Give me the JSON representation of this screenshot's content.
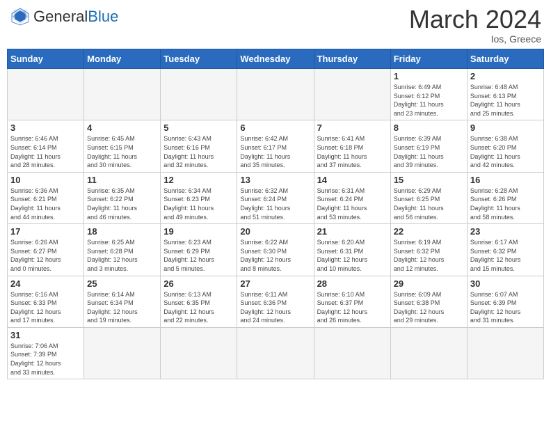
{
  "header": {
    "logo_general": "General",
    "logo_blue": "Blue",
    "month_title": "March 2024",
    "subtitle": "Ios, Greece"
  },
  "days_of_week": [
    "Sunday",
    "Monday",
    "Tuesday",
    "Wednesday",
    "Thursday",
    "Friday",
    "Saturday"
  ],
  "weeks": [
    {
      "days": [
        {
          "number": "",
          "info": "",
          "empty": true
        },
        {
          "number": "",
          "info": "",
          "empty": true
        },
        {
          "number": "",
          "info": "",
          "empty": true
        },
        {
          "number": "",
          "info": "",
          "empty": true
        },
        {
          "number": "",
          "info": "",
          "empty": true
        },
        {
          "number": "1",
          "info": "Sunrise: 6:49 AM\nSunset: 6:12 PM\nDaylight: 11 hours\nand 23 minutes."
        },
        {
          "number": "2",
          "info": "Sunrise: 6:48 AM\nSunset: 6:13 PM\nDaylight: 11 hours\nand 25 minutes."
        }
      ]
    },
    {
      "days": [
        {
          "number": "3",
          "info": "Sunrise: 6:46 AM\nSunset: 6:14 PM\nDaylight: 11 hours\nand 28 minutes."
        },
        {
          "number": "4",
          "info": "Sunrise: 6:45 AM\nSunset: 6:15 PM\nDaylight: 11 hours\nand 30 minutes."
        },
        {
          "number": "5",
          "info": "Sunrise: 6:43 AM\nSunset: 6:16 PM\nDaylight: 11 hours\nand 32 minutes."
        },
        {
          "number": "6",
          "info": "Sunrise: 6:42 AM\nSunset: 6:17 PM\nDaylight: 11 hours\nand 35 minutes."
        },
        {
          "number": "7",
          "info": "Sunrise: 6:41 AM\nSunset: 6:18 PM\nDaylight: 11 hours\nand 37 minutes."
        },
        {
          "number": "8",
          "info": "Sunrise: 6:39 AM\nSunset: 6:19 PM\nDaylight: 11 hours\nand 39 minutes."
        },
        {
          "number": "9",
          "info": "Sunrise: 6:38 AM\nSunset: 6:20 PM\nDaylight: 11 hours\nand 42 minutes."
        }
      ]
    },
    {
      "days": [
        {
          "number": "10",
          "info": "Sunrise: 6:36 AM\nSunset: 6:21 PM\nDaylight: 11 hours\nand 44 minutes."
        },
        {
          "number": "11",
          "info": "Sunrise: 6:35 AM\nSunset: 6:22 PM\nDaylight: 11 hours\nand 46 minutes."
        },
        {
          "number": "12",
          "info": "Sunrise: 6:34 AM\nSunset: 6:23 PM\nDaylight: 11 hours\nand 49 minutes."
        },
        {
          "number": "13",
          "info": "Sunrise: 6:32 AM\nSunset: 6:24 PM\nDaylight: 11 hours\nand 51 minutes."
        },
        {
          "number": "14",
          "info": "Sunrise: 6:31 AM\nSunset: 6:24 PM\nDaylight: 11 hours\nand 53 minutes."
        },
        {
          "number": "15",
          "info": "Sunrise: 6:29 AM\nSunset: 6:25 PM\nDaylight: 11 hours\nand 56 minutes."
        },
        {
          "number": "16",
          "info": "Sunrise: 6:28 AM\nSunset: 6:26 PM\nDaylight: 11 hours\nand 58 minutes."
        }
      ]
    },
    {
      "days": [
        {
          "number": "17",
          "info": "Sunrise: 6:26 AM\nSunset: 6:27 PM\nDaylight: 12 hours\nand 0 minutes."
        },
        {
          "number": "18",
          "info": "Sunrise: 6:25 AM\nSunset: 6:28 PM\nDaylight: 12 hours\nand 3 minutes."
        },
        {
          "number": "19",
          "info": "Sunrise: 6:23 AM\nSunset: 6:29 PM\nDaylight: 12 hours\nand 5 minutes."
        },
        {
          "number": "20",
          "info": "Sunrise: 6:22 AM\nSunset: 6:30 PM\nDaylight: 12 hours\nand 8 minutes."
        },
        {
          "number": "21",
          "info": "Sunrise: 6:20 AM\nSunset: 6:31 PM\nDaylight: 12 hours\nand 10 minutes."
        },
        {
          "number": "22",
          "info": "Sunrise: 6:19 AM\nSunset: 6:32 PM\nDaylight: 12 hours\nand 12 minutes."
        },
        {
          "number": "23",
          "info": "Sunrise: 6:17 AM\nSunset: 6:32 PM\nDaylight: 12 hours\nand 15 minutes."
        }
      ]
    },
    {
      "days": [
        {
          "number": "24",
          "info": "Sunrise: 6:16 AM\nSunset: 6:33 PM\nDaylight: 12 hours\nand 17 minutes."
        },
        {
          "number": "25",
          "info": "Sunrise: 6:14 AM\nSunset: 6:34 PM\nDaylight: 12 hours\nand 19 minutes."
        },
        {
          "number": "26",
          "info": "Sunrise: 6:13 AM\nSunset: 6:35 PM\nDaylight: 12 hours\nand 22 minutes."
        },
        {
          "number": "27",
          "info": "Sunrise: 6:11 AM\nSunset: 6:36 PM\nDaylight: 12 hours\nand 24 minutes."
        },
        {
          "number": "28",
          "info": "Sunrise: 6:10 AM\nSunset: 6:37 PM\nDaylight: 12 hours\nand 26 minutes."
        },
        {
          "number": "29",
          "info": "Sunrise: 6:09 AM\nSunset: 6:38 PM\nDaylight: 12 hours\nand 29 minutes."
        },
        {
          "number": "30",
          "info": "Sunrise: 6:07 AM\nSunset: 6:39 PM\nDaylight: 12 hours\nand 31 minutes."
        }
      ]
    },
    {
      "days": [
        {
          "number": "31",
          "info": "Sunrise: 7:06 AM\nSunset: 7:39 PM\nDaylight: 12 hours\nand 33 minutes.",
          "last": true
        },
        {
          "number": "",
          "info": "",
          "empty": true
        },
        {
          "number": "",
          "info": "",
          "empty": true
        },
        {
          "number": "",
          "info": "",
          "empty": true
        },
        {
          "number": "",
          "info": "",
          "empty": true
        },
        {
          "number": "",
          "info": "",
          "empty": true
        },
        {
          "number": "",
          "info": "",
          "empty": true
        }
      ]
    }
  ]
}
